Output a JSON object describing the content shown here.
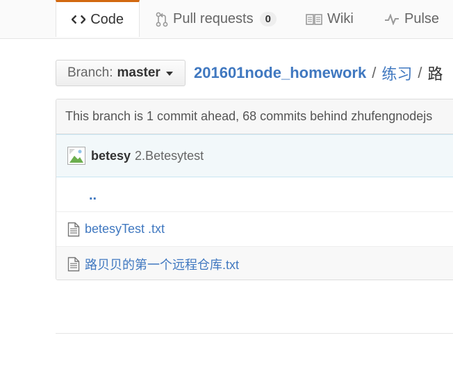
{
  "tabs": {
    "code": {
      "label": "Code",
      "icon": "code-icon"
    },
    "pulls": {
      "label": "Pull requests",
      "count": "0",
      "icon": "git-pull-request-icon"
    },
    "wiki": {
      "label": "Wiki",
      "icon": "book-icon"
    },
    "pulse": {
      "label": "Pulse",
      "icon": "pulse-icon"
    }
  },
  "branch": {
    "label": "Branch:",
    "name": "master"
  },
  "breadcrumb": {
    "repo": "201601node_homework",
    "sep1": "/",
    "folder": "练习",
    "sep2": "/",
    "current": "路"
  },
  "status": {
    "ahead_text": "This branch is 1 commit ahead, 68 commits behind zhufengnodejs"
  },
  "commit": {
    "author": "betesy",
    "message": "2.Betesytest"
  },
  "files": {
    "parent": "..",
    "items": [
      {
        "name": "betesyTest .txt",
        "icon": "file-text-icon"
      },
      {
        "name": "路贝贝的第一个远程仓库.txt",
        "icon": "file-text-icon"
      }
    ]
  },
  "colors": {
    "accent_tab": "#d26911",
    "link": "#4078c0",
    "commit_bg": "#f2f8fa"
  }
}
